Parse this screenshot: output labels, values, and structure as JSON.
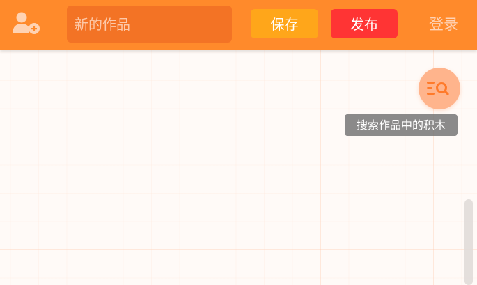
{
  "header": {
    "user_icon": "add-user-icon",
    "title_placeholder": "新的作品",
    "save_label": "保存",
    "publish_label": "发布",
    "login_label": "登录"
  },
  "workspace": {
    "search_icon": "search-blocks-icon",
    "search_tooltip": "搜索作品中的积木"
  },
  "colors": {
    "topbar": "#ff8a2b",
    "title_input_bg": "#f37325",
    "save_button": "#ffa61a",
    "publish_button": "#ff3434",
    "search_fab": "#ffb48c",
    "workspace_bg": "#fffaf7"
  }
}
